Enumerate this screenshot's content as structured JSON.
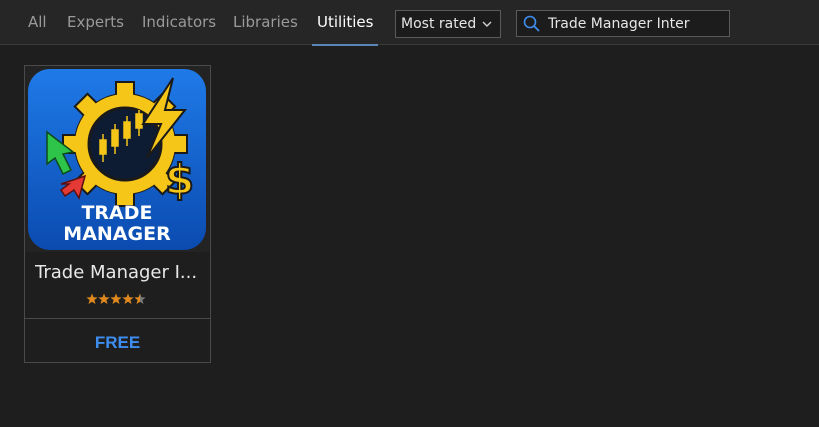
{
  "tabs": [
    {
      "label": "All",
      "active": false
    },
    {
      "label": "Experts",
      "active": false
    },
    {
      "label": "Indicators",
      "active": false
    },
    {
      "label": "Libraries",
      "active": false
    },
    {
      "label": "Utilities",
      "active": true
    }
  ],
  "sort": {
    "selected": "Most rated"
  },
  "search": {
    "value": "Trade Manager Inter"
  },
  "products": [
    {
      "name": "Trade Manager I...",
      "logo_text_line1": "TRADE",
      "logo_text_line2": "MANAGER",
      "rating": 4.5,
      "rating_max": 5,
      "price": "FREE"
    }
  ],
  "colors": {
    "accent": "#3d8ef0",
    "active_tab_underline": "#5c86b8",
    "star": "#e08a1e",
    "logo_bg": "#1565d8",
    "logo_gold": "#f5c518"
  }
}
